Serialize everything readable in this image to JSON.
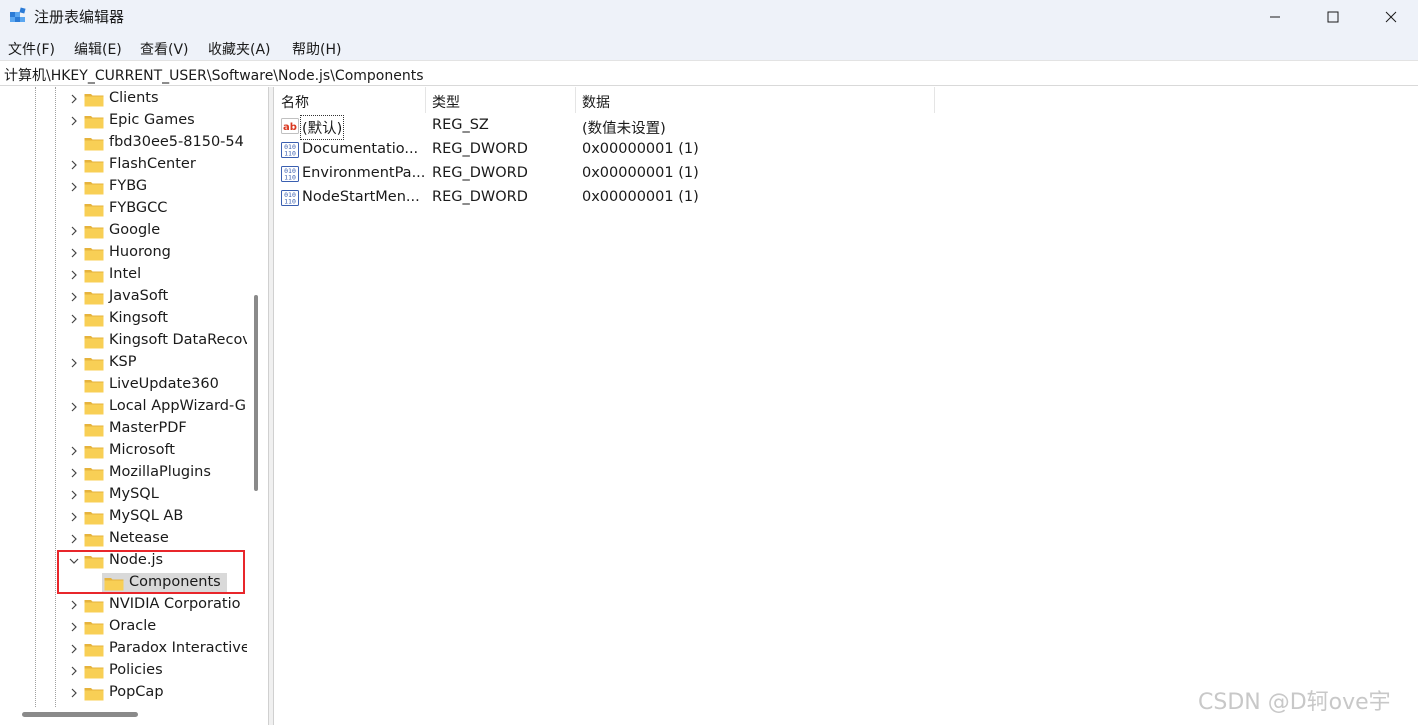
{
  "window": {
    "title": "注册表编辑器",
    "icon": "regedit-icon",
    "controls": [
      "minimize-icon",
      "maximize-icon",
      "close-icon"
    ]
  },
  "menu": {
    "items": [
      "文件(F)",
      "编辑(E)",
      "查看(V)",
      "收藏夹(A)",
      "帮助(H)"
    ]
  },
  "address": {
    "path": "计算机\\HKEY_CURRENT_USER\\Software\\Node.js\\Components"
  },
  "tree": {
    "items": [
      {
        "label": "Clients",
        "expander": "collapsed"
      },
      {
        "label": "Epic Games",
        "expander": "collapsed"
      },
      {
        "label": "fbd30ee5-8150-54",
        "expander": "none"
      },
      {
        "label": "FlashCenter",
        "expander": "collapsed"
      },
      {
        "label": "FYBG",
        "expander": "collapsed"
      },
      {
        "label": "FYBGCC",
        "expander": "none"
      },
      {
        "label": "Google",
        "expander": "collapsed"
      },
      {
        "label": "Huorong",
        "expander": "collapsed"
      },
      {
        "label": "Intel",
        "expander": "collapsed"
      },
      {
        "label": "JavaSoft",
        "expander": "collapsed"
      },
      {
        "label": "Kingsoft",
        "expander": "collapsed"
      },
      {
        "label": "Kingsoft DataRecov",
        "expander": "none"
      },
      {
        "label": "KSP",
        "expander": "collapsed"
      },
      {
        "label": "LiveUpdate360",
        "expander": "none"
      },
      {
        "label": "Local AppWizard-G",
        "expander": "collapsed"
      },
      {
        "label": "MasterPDF",
        "expander": "none"
      },
      {
        "label": "Microsoft",
        "expander": "collapsed"
      },
      {
        "label": "MozillaPlugins",
        "expander": "collapsed"
      },
      {
        "label": "MySQL",
        "expander": "collapsed"
      },
      {
        "label": "MySQL AB",
        "expander": "collapsed"
      },
      {
        "label": "Netease",
        "expander": "collapsed"
      },
      {
        "label": "Node.js",
        "expander": "expanded"
      },
      {
        "label": "Components",
        "expander": "none",
        "child": true,
        "selected": true
      },
      {
        "label": "NVIDIA Corporatio",
        "expander": "collapsed"
      },
      {
        "label": "Oracle",
        "expander": "collapsed"
      },
      {
        "label": "Paradox Interactive",
        "expander": "collapsed"
      },
      {
        "label": "Policies",
        "expander": "collapsed"
      },
      {
        "label": "PopCap",
        "expander": "collapsed"
      }
    ]
  },
  "list": {
    "columns": [
      "名称",
      "类型",
      "数据"
    ],
    "rows": [
      {
        "icon": "string-value-icon",
        "name": "(默认)",
        "type": "REG_SZ",
        "data": "(数值未设置)",
        "focused": true
      },
      {
        "icon": "binary-value-icon",
        "name": "Documentatio...",
        "type": "REG_DWORD",
        "data": "0x00000001 (1)"
      },
      {
        "icon": "binary-value-icon",
        "name": "EnvironmentPa...",
        "type": "REG_DWORD",
        "data": "0x00000001 (1)"
      },
      {
        "icon": "binary-value-icon",
        "name": "NodeStartMen...",
        "type": "REG_DWORD",
        "data": "0x00000001 (1)"
      }
    ]
  },
  "watermark": "CSDN @D轲ove宇",
  "colors": {
    "chrome": "#eef2f9",
    "folder": "#f5c84a",
    "highlight": "#e8262b",
    "selection": "#d9d9d9"
  }
}
